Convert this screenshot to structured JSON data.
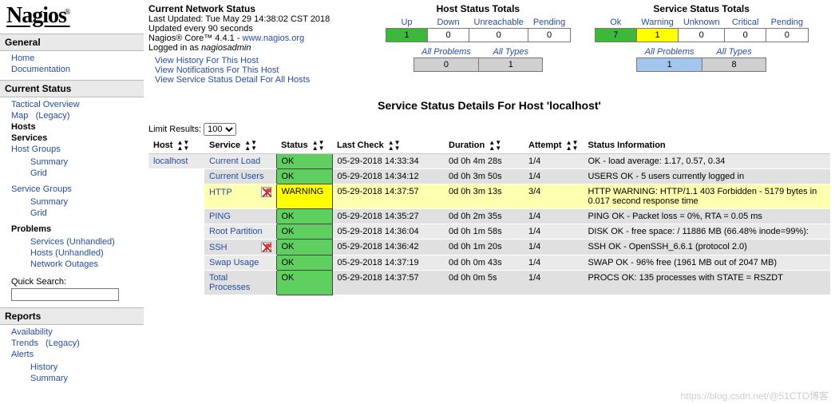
{
  "brand": {
    "name": "Nagios",
    "sup": "®"
  },
  "sidebar": {
    "sections": [
      {
        "title": "General",
        "items": [
          {
            "l": "Home"
          },
          {
            "l": "Documentation"
          }
        ]
      },
      {
        "title": "Current Status",
        "items": [
          {
            "l": "Tactical Overview"
          },
          {
            "l": "Map",
            "aux": "(Legacy)"
          },
          {
            "l": "Hosts",
            "plain": true
          },
          {
            "l": "Services",
            "plain": true
          },
          {
            "l": "Host Groups",
            "sub": [
              {
                "l": "Summary"
              },
              {
                "l": "Grid"
              }
            ]
          },
          {
            "l": "Service Groups",
            "sub": [
              {
                "l": "Summary"
              },
              {
                "l": "Grid"
              }
            ]
          },
          {
            "l": "Problems",
            "plain": true,
            "sub": [
              {
                "l": "Services (Unhandled)"
              },
              {
                "l": "Hosts (Unhandled)"
              },
              {
                "l": "Network Outages"
              }
            ]
          }
        ],
        "extra": {
          "qs_label": "Quick Search:"
        }
      },
      {
        "title": "Reports",
        "items": [
          {
            "l": "Availability"
          },
          {
            "l": "Trends",
            "aux": "(Legacy)"
          },
          {
            "l": "Alerts",
            "sub": [
              {
                "l": "History"
              },
              {
                "l": "Summary"
              }
            ]
          }
        ]
      }
    ]
  },
  "status_block": {
    "title": "Current Network Status",
    "last_updated": "Last Updated: Tue May 29 14:38:02 CST 2018",
    "update_every": "Updated every 90 seconds",
    "product": "Nagios® Core™ 4.4.1 - ",
    "product_link": "www.nagios.org",
    "logged_in_pre": "Logged in as ",
    "logged_in_user": "nagiosadmin",
    "links": [
      "View History For This Host",
      "View Notifications For This Host",
      "View Service Status Detail For All Hosts"
    ]
  },
  "host_totals": {
    "title": "Host Status Totals",
    "cols": [
      "Up",
      "Down",
      "Unreachable",
      "Pending"
    ],
    "vals": [
      "1",
      "0",
      "0",
      "0"
    ],
    "all_cols": [
      "All Problems",
      "All Types"
    ],
    "all_vals": [
      "0",
      "1"
    ]
  },
  "service_totals": {
    "title": "Service Status Totals",
    "cols": [
      "Ok",
      "Warning",
      "Unknown",
      "Critical",
      "Pending"
    ],
    "vals": [
      "7",
      "1",
      "0",
      "0",
      "0"
    ],
    "all_cols": [
      "All Problems",
      "All Types"
    ],
    "all_vals": [
      "1",
      "8"
    ]
  },
  "page_title": "Service Status Details For Host 'localhost'",
  "limit": {
    "label": "Limit Results:",
    "value": "100",
    "options": [
      "100"
    ]
  },
  "table": {
    "headers": [
      "Host",
      "Service",
      "Status",
      "Last Check",
      "Duration",
      "Attempt",
      "Status Information"
    ],
    "host": "localhost",
    "rows": [
      {
        "svc": "Current Load",
        "st": "OK",
        "lc": "05-29-2018 14:33:34",
        "du": "0d 0h 4m 28s",
        "at": "1/4",
        "info": "OK - load average: 1.17, 0.57, 0.34"
      },
      {
        "svc": "Current Users",
        "st": "OK",
        "lc": "05-29-2018 14:34:12",
        "du": "0d 0h 3m 50s",
        "at": "1/4",
        "info": "USERS OK - 5 users currently logged in"
      },
      {
        "svc": "HTTP",
        "flag": true,
        "st": "WARNING",
        "lc": "05-29-2018 14:37:57",
        "du": "0d 0h 3m 13s",
        "at": "3/4",
        "info": "HTTP WARNING: HTTP/1.1 403 Forbidden - 5179 bytes in 0.017 second response time"
      },
      {
        "svc": "PING",
        "st": "OK",
        "lc": "05-29-2018 14:35:27",
        "du": "0d 0h 2m 35s",
        "at": "1/4",
        "info": "PING OK - Packet loss = 0%, RTA = 0.05 ms"
      },
      {
        "svc": "Root Partition",
        "st": "OK",
        "lc": "05-29-2018 14:36:04",
        "du": "0d 0h 1m 58s",
        "at": "1/4",
        "info": "DISK OK - free space: / 11886 MB (66.48% inode=99%):"
      },
      {
        "svc": "SSH",
        "flag": true,
        "st": "OK",
        "lc": "05-29-2018 14:36:42",
        "du": "0d 0h 1m 20s",
        "at": "1/4",
        "info": "SSH OK - OpenSSH_6.6.1 (protocol 2.0)"
      },
      {
        "svc": "Swap Usage",
        "st": "OK",
        "lc": "05-29-2018 14:37:19",
        "du": "0d 0h 0m 43s",
        "at": "1/4",
        "info": "SWAP OK - 96% free (1961 MB out of 2047 MB)"
      },
      {
        "svc": "Total Processes",
        "st": "OK",
        "lc": "05-29-2018 14:37:57",
        "du": "0d 0h 0m 5s",
        "at": "1/4",
        "info": "PROCS OK: 135 processes with STATE = RSZDT"
      }
    ]
  },
  "watermark": "https://blog.csdn.net/@51CTO博客"
}
